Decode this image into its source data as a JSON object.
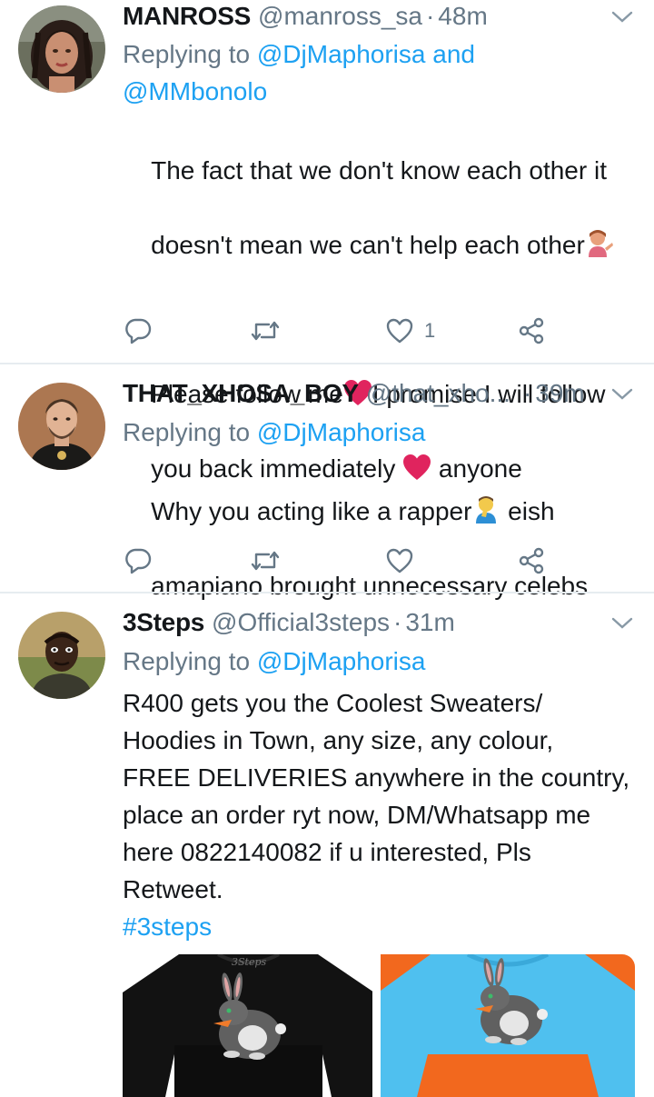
{
  "tweets": [
    {
      "name": "MANROSS",
      "handle": "@manross_sa",
      "separator": "·",
      "time": "48m",
      "replying_prefix": "Replying to ",
      "replying_mentions": "@DjMaphorisa and",
      "replying_mentions_2": "@MMbonolo",
      "text_line1": "The fact that we don't know each other it",
      "text_line2": "doesn't mean we can't help each other",
      "text_line3": "Please follow me",
      "text_line3b": "I promise I will follow",
      "text_line4": "you back immediately ",
      "text_line4b": " anyone",
      "like_count": "1"
    },
    {
      "name": "THAT_XHOSA_BOY",
      "handle": "@that_xho...",
      "separator": "·",
      "time": "39m",
      "replying_prefix": "Replying to ",
      "replying_mentions": "@DjMaphorisa",
      "text_line1": "Why you acting like a rapper",
      "text_line1b": " eish",
      "text_line2": "amapiano brought unnecessary celebs"
    },
    {
      "name": "3Steps",
      "handle": "@Official3steps",
      "separator": "·",
      "time": "31m",
      "replying_prefix": "Replying to ",
      "replying_mentions": "@DjMaphorisa",
      "text": "R400 gets you the Coolest Sweaters/\nHoodies in Town, any size, any colour,\nFREE DELIVERIES anywhere in the country,\nplace an order ryt now, DM/Whatsapp me\nhere 0822140082 if u interested, Pls\nRetweet.",
      "hashtag": "#3steps",
      "media_logo": "3Steps"
    }
  ],
  "colors": {
    "accent": "#1da1f2",
    "secondary_text": "#657786",
    "divider": "#e6ecf0",
    "heart": "#e0245e"
  },
  "icons": [
    "reply-icon",
    "retweet-icon",
    "like-icon",
    "share-icon",
    "caret-down-icon"
  ]
}
